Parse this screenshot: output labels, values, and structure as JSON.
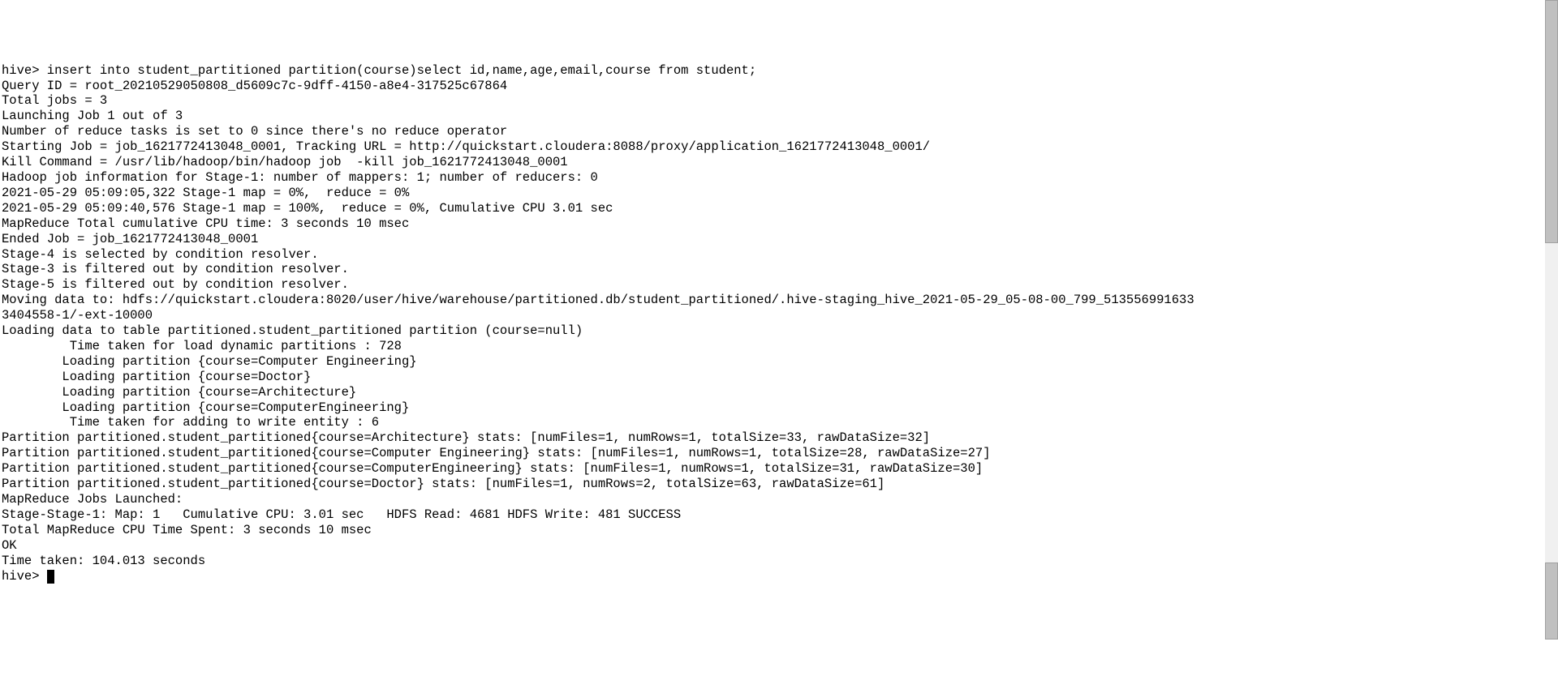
{
  "terminal": {
    "lines": [
      "hive> insert into student_partitioned partition(course)select id,name,age,email,course from student;",
      "Query ID = root_20210529050808_d5609c7c-9dff-4150-a8e4-317525c67864",
      "Total jobs = 3",
      "Launching Job 1 out of 3",
      "Number of reduce tasks is set to 0 since there's no reduce operator",
      "Starting Job = job_1621772413048_0001, Tracking URL = http://quickstart.cloudera:8088/proxy/application_1621772413048_0001/",
      "Kill Command = /usr/lib/hadoop/bin/hadoop job  -kill job_1621772413048_0001",
      "Hadoop job information for Stage-1: number of mappers: 1; number of reducers: 0",
      "2021-05-29 05:09:05,322 Stage-1 map = 0%,  reduce = 0%",
      "2021-05-29 05:09:40,576 Stage-1 map = 100%,  reduce = 0%, Cumulative CPU 3.01 sec",
      "MapReduce Total cumulative CPU time: 3 seconds 10 msec",
      "Ended Job = job_1621772413048_0001",
      "Stage-4 is selected by condition resolver.",
      "Stage-3 is filtered out by condition resolver.",
      "Stage-5 is filtered out by condition resolver.",
      "Moving data to: hdfs://quickstart.cloudera:8020/user/hive/warehouse/partitioned.db/student_partitioned/.hive-staging_hive_2021-05-29_05-08-00_799_513556991633",
      "3404558-1/-ext-10000",
      "Loading data to table partitioned.student_partitioned partition (course=null)",
      "         Time taken for load dynamic partitions : 728",
      "        Loading partition {course=Computer Engineering}",
      "        Loading partition {course=Doctor}",
      "        Loading partition {course=Architecture}",
      "        Loading partition {course=ComputerEngineering}",
      "         Time taken for adding to write entity : 6",
      "Partition partitioned.student_partitioned{course=Architecture} stats: [numFiles=1, numRows=1, totalSize=33, rawDataSize=32]",
      "Partition partitioned.student_partitioned{course=Computer Engineering} stats: [numFiles=1, numRows=1, totalSize=28, rawDataSize=27]",
      "Partition partitioned.student_partitioned{course=ComputerEngineering} stats: [numFiles=1, numRows=1, totalSize=31, rawDataSize=30]",
      "Partition partitioned.student_partitioned{course=Doctor} stats: [numFiles=1, numRows=2, totalSize=63, rawDataSize=61]",
      "MapReduce Jobs Launched:",
      "Stage-Stage-1: Map: 1   Cumulative CPU: 3.01 sec   HDFS Read: 4681 HDFS Write: 481 SUCCESS",
      "Total MapReduce CPU Time Spent: 3 seconds 10 msec",
      "OK",
      "Time taken: 104.013 seconds"
    ],
    "prompt": "hive> "
  }
}
